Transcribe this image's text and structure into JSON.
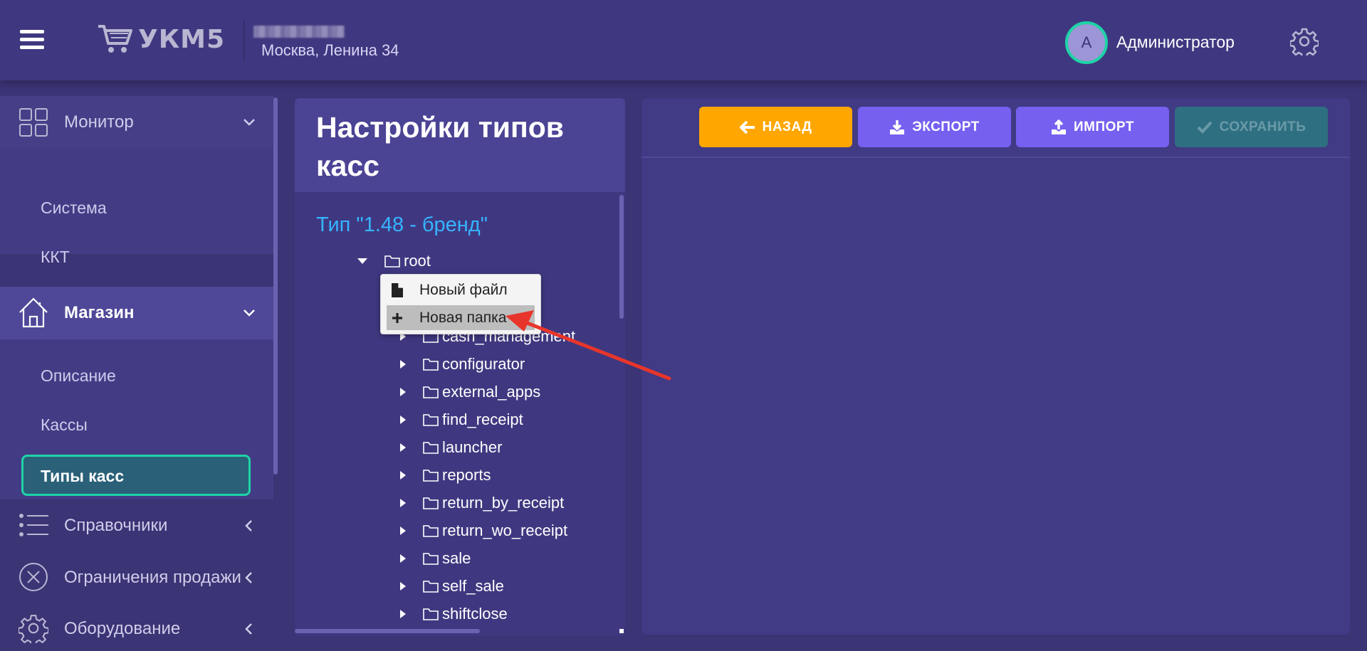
{
  "header": {
    "logo_text": "УКМ5",
    "store_address": "Москва, Ленина 34",
    "avatar_letter": "А",
    "user_name": "Администратор"
  },
  "sidebar": {
    "monitor": "Монитор",
    "monitor_items": [
      "Система",
      "ККТ"
    ],
    "shop": "Магазин",
    "shop_items": [
      "Описание",
      "Кассы",
      "Типы касс"
    ],
    "dictionaries": "Справочники",
    "restrictions": "Ограничения продажи",
    "equipment": "Оборудование"
  },
  "tree": {
    "title": "Настройки типов касс",
    "type_label": "Тип \"1.48 - бренд\"",
    "root": "root",
    "children": [
      "cash_management",
      "configurator",
      "external_apps",
      "find_receipt",
      "launcher",
      "reports",
      "return_by_receipt",
      "return_wo_receipt",
      "sale",
      "self_sale",
      "shiftclose"
    ]
  },
  "context_menu": {
    "new_file": "Новый файл",
    "new_folder": "Новая папка"
  },
  "toolbar": {
    "back": "НАЗАД",
    "export": "ЭКСПОРТ",
    "import": "ИМПОРТ",
    "save": "СОХРАНИТЬ"
  },
  "colors": {
    "background": "#3b3475",
    "accent_green": "#1fd3a6",
    "back_button": "#ffa700",
    "primary_button": "#7560f0",
    "disabled_button": "#2f6f82",
    "type_label": "#36b4ff",
    "annotation_arrow": "#e8352b"
  }
}
